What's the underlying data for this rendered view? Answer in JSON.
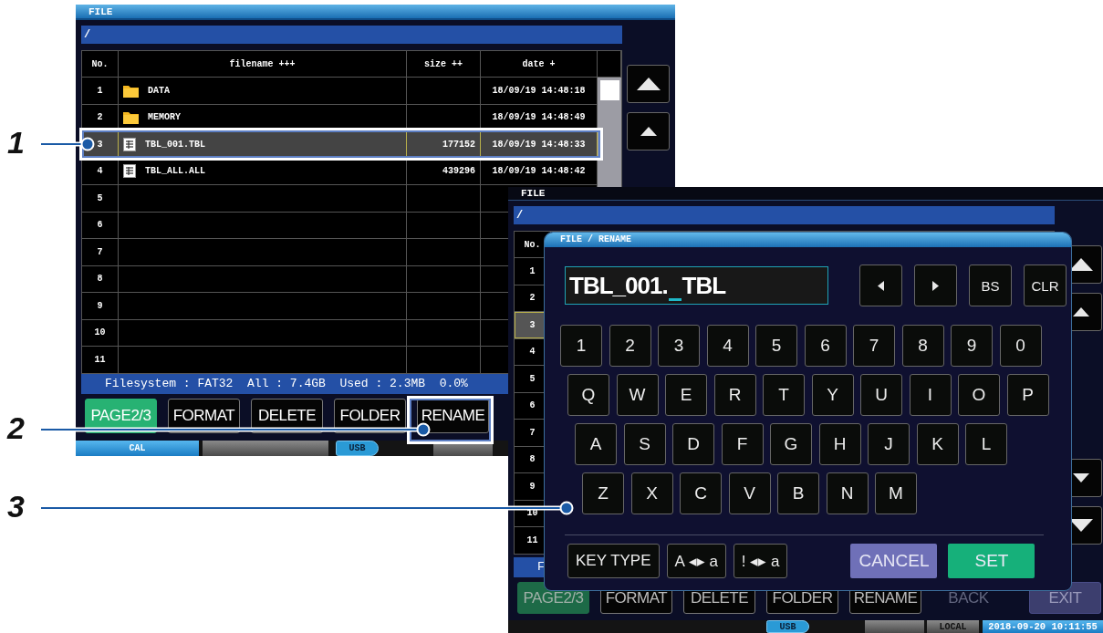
{
  "screens": [
    {
      "title": "FILE",
      "dimmed": false,
      "path": "/",
      "columns": [
        "No.",
        "filename +++",
        "size ++",
        "date +"
      ],
      "rows": [
        {
          "no": "1",
          "kind": "folder",
          "name": "DATA",
          "date": "18/09/19 14:48:18",
          "selected": false
        },
        {
          "no": "2",
          "kind": "folder",
          "name": "MEMORY",
          "date": "18/09/19 14:48:49",
          "selected": false
        },
        {
          "no": "3",
          "kind": "file",
          "name": "TBL_001.TBL",
          "size": "177152",
          "date": "18/09/19 14:48:33",
          "selected": true
        },
        {
          "no": "4",
          "kind": "file",
          "name": "TBL_ALL.ALL",
          "size": "439296",
          "date": "18/09/19 14:48:42",
          "selected": false
        },
        {
          "no": "5",
          "kind": "empty",
          "selected": false
        },
        {
          "no": "6",
          "kind": "empty",
          "selected": false
        },
        {
          "no": "7",
          "kind": "empty",
          "selected": false
        },
        {
          "no": "8",
          "kind": "empty",
          "selected": false
        },
        {
          "no": "9",
          "kind": "empty",
          "selected": false
        },
        {
          "no": "10",
          "kind": "empty",
          "selected": false
        },
        {
          "no": "11",
          "kind": "empty",
          "selected": false
        }
      ],
      "scroll_buttons": [
        {
          "kind": "page_up"
        },
        {
          "kind": "line_up"
        }
      ],
      "status_line": "Filesystem : FAT32  All : 7.4GB  Used : 2.3MB  0.0%",
      "buttons": [
        {
          "label": "PAGE2/3",
          "kind": "page",
          "disabled": false
        },
        {
          "label": "FORMAT",
          "kind": "plain",
          "disabled": false
        },
        {
          "label": "DELETE",
          "kind": "plain",
          "disabled": false
        },
        {
          "label": "FOLDER",
          "kind": "plain",
          "disabled": false
        },
        {
          "label": "RENAME",
          "kind": "plain",
          "disabled": false
        }
      ],
      "status_bar": [
        {
          "kind": "mode",
          "label": "CAL"
        },
        {
          "kind": "blank"
        },
        {
          "kind": "usb",
          "label": "USB"
        },
        {
          "kind": "blank"
        }
      ]
    },
    {
      "title": "FILE",
      "dimmed": true,
      "path": "/",
      "columns": [
        "No."
      ],
      "rows": [
        {
          "no": "1",
          "selected": false
        },
        {
          "no": "2",
          "selected": false
        },
        {
          "no": "3",
          "selected": true
        },
        {
          "no": "4",
          "selected": false
        },
        {
          "no": "5",
          "selected": false
        },
        {
          "no": "6",
          "selected": false
        },
        {
          "no": "7",
          "selected": false
        },
        {
          "no": "8",
          "selected": false
        },
        {
          "no": "9",
          "selected": false
        },
        {
          "no": "10",
          "selected": false
        },
        {
          "no": "11",
          "selected": false
        }
      ],
      "scroll_buttons": [
        {
          "kind": "page_up"
        },
        {
          "kind": "line_up"
        },
        {
          "kind": "line_down"
        },
        {
          "kind": "page_down"
        }
      ],
      "status_line": "F",
      "buttons": [
        {
          "label": "PAGE2/3",
          "kind": "page",
          "disabled": false
        },
        {
          "label": "FORMAT",
          "kind": "plain",
          "disabled": false
        },
        {
          "label": "DELETE",
          "kind": "plain",
          "disabled": false
        },
        {
          "label": "FOLDER",
          "kind": "plain",
          "disabled": false
        },
        {
          "label": "RENAME",
          "kind": "plain",
          "disabled": false
        },
        {
          "label": "BACK",
          "kind": "plain",
          "disabled": true
        },
        {
          "label": "EXIT",
          "kind": "exit",
          "disabled": false
        }
      ],
      "status_bar": [
        {
          "kind": "usb",
          "label": "USB"
        },
        {
          "kind": "blank"
        },
        {
          "kind": "local",
          "label": "LOCAL"
        },
        {
          "kind": "clock",
          "label": "2018-09-20 10:11:55"
        }
      ],
      "dialog": {
        "title": "FILE / RENAME",
        "field": {
          "text_before_cursor": "TBL_001.",
          "text_after_cursor": "TBL"
        },
        "nav_keys": [
          {
            "kind": "left"
          },
          {
            "kind": "right"
          },
          {
            "kind": "text",
            "label": "BS"
          },
          {
            "kind": "text",
            "label": "CLR"
          }
        ],
        "key_rows": [
          [
            "1",
            "2",
            "3",
            "4",
            "5",
            "6",
            "7",
            "8",
            "9",
            "0"
          ],
          [
            "Q",
            "W",
            "E",
            "R",
            "T",
            "Y",
            "U",
            "I",
            "O",
            "P"
          ],
          [
            "A",
            "S",
            "D",
            "F",
            "G",
            "H",
            "J",
            "K",
            "L"
          ],
          [
            "Z",
            "X",
            "C",
            "V",
            "B",
            "N",
            "M"
          ]
        ],
        "mode_keys": [
          "KEY TYPE",
          "A ◂▸ a",
          "! ◂▸ a"
        ],
        "actions": [
          {
            "label": "CANCEL",
            "kind": "cancel"
          },
          {
            "label": "SET",
            "kind": "set"
          }
        ]
      }
    }
  ],
  "callouts": [
    {
      "number": "1"
    },
    {
      "number": "2"
    },
    {
      "number": "3"
    }
  ]
}
